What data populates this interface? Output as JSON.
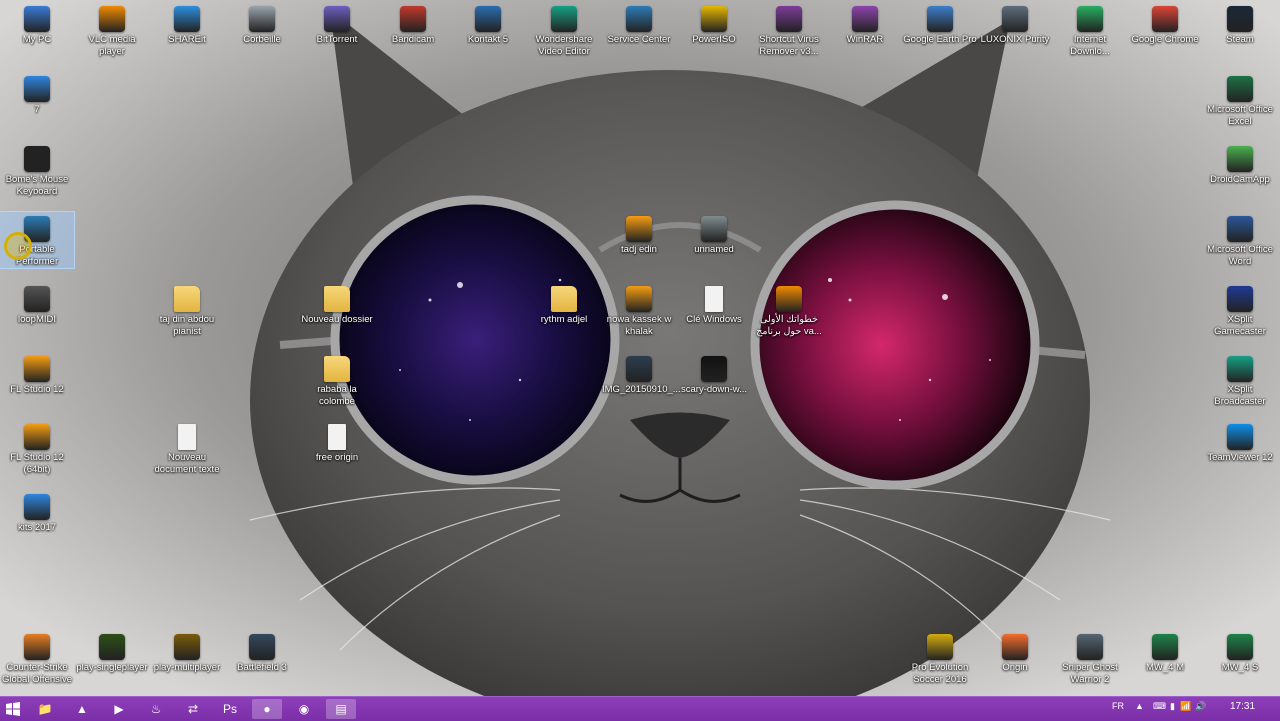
{
  "desktop": {
    "icons": [
      {
        "label": "My PC",
        "icon": "computer-icon",
        "color": "#3a7bd5"
      },
      {
        "label": "VLC media player",
        "icon": "vlc-icon",
        "color": "#f08a00"
      },
      {
        "label": "SHAREit",
        "icon": "shareit-icon",
        "color": "#2b8fe0"
      },
      {
        "label": "Corbeille",
        "icon": "recycle-bin-icon",
        "color": "#9aa4ad"
      },
      {
        "label": "BitTorrent",
        "icon": "bittorrent-icon",
        "color": "#6b5fc0"
      },
      {
        "label": "Bandicam",
        "icon": "bandicam-icon",
        "color": "#c0392b"
      },
      {
        "label": "Kontakt 5",
        "icon": "kontakt-icon",
        "color": "#2b6cb0"
      },
      {
        "label": "Wondershare Video Editor",
        "icon": "video-editor-icon",
        "color": "#16a085"
      },
      {
        "label": "Service Center",
        "icon": "service-center-icon",
        "color": "#2c7bb6"
      },
      {
        "label": "PowerISO",
        "icon": "poweriso-icon",
        "color": "#e6b800"
      },
      {
        "label": "Shortcut Virus Remover v3...",
        "icon": "virus-remover-icon",
        "color": "#7d3c98"
      },
      {
        "label": "WinRAR",
        "icon": "winrar-icon",
        "color": "#8e44ad"
      },
      {
        "label": "Google Earth Pro",
        "icon": "google-earth-icon",
        "color": "#3d7ec9"
      },
      {
        "label": "LUXONIX Purity",
        "icon": "luxonix-icon",
        "color": "#5d6d7e"
      },
      {
        "label": "Internet Downlo...",
        "icon": "internet-download-icon",
        "color": "#27ae60"
      },
      {
        "label": "Google Chrome",
        "icon": "chrome-icon",
        "color": "#db4437"
      },
      {
        "label": "Steam",
        "icon": "steam-icon",
        "color": "#1b2838"
      },
      {
        "label": "7",
        "icon": "gamepad-icon",
        "color": "#2e86de"
      },
      {
        "label": "Microsoft Office Excel",
        "icon": "excel-icon",
        "color": "#1e7145"
      },
      {
        "label": "Bome's Mouse Keyboard",
        "icon": "piano-keyboard-icon",
        "color": "#222222"
      },
      {
        "label": "DroidCamApp",
        "icon": "droidcam-icon",
        "color": "#4caf50"
      },
      {
        "label": "Portable Performer",
        "icon": "performer-icon",
        "color": "#2c7bb6"
      },
      {
        "label": "Microsoft Office Word",
        "icon": "word-icon",
        "color": "#2b579a"
      },
      {
        "label": "tadj edin",
        "icon": "fl-studio-icon",
        "color": "#f39c12"
      },
      {
        "label": "unnamed",
        "icon": "image-file-icon",
        "color": "#7f8c8d"
      },
      {
        "label": "loopMIDI",
        "icon": "loopmidi-icon",
        "color": "#555555"
      },
      {
        "label": "taj din abdou pianist",
        "icon": "folder-icon",
        "color": "#e3b43f"
      },
      {
        "label": "Nouveau dossier",
        "icon": "folder-icon",
        "color": "#e3b43f"
      },
      {
        "label": "rythm adjel",
        "icon": "folder-icon",
        "color": "#e3b43f"
      },
      {
        "label": "nowa kassek w khalak",
        "icon": "fl-studio-icon",
        "color": "#f39c12"
      },
      {
        "label": "Clé Windows",
        "icon": "text-file-icon",
        "color": "#f2f2f2"
      },
      {
        "label": "خطواتك الأولى حول برنامج va...",
        "icon": "vlc-file-icon",
        "color": "#f08a00"
      },
      {
        "label": "XSplit Gamecaster",
        "icon": "xsplit-gamecaster-icon",
        "color": "#1f3a93"
      },
      {
        "label": "FL Studio 12",
        "icon": "fl-studio-icon",
        "color": "#f39c12"
      },
      {
        "label": "rababa la colombe",
        "icon": "folder-icon",
        "color": "#e3b43f"
      },
      {
        "label": "IMG_20150910_...",
        "icon": "image-file-icon",
        "color": "#2c3e50"
      },
      {
        "label": "scary-down-w...",
        "icon": "image-file-icon",
        "color": "#111111"
      },
      {
        "label": "XSplit Broadcaster",
        "icon": "xsplit-broadcaster-icon",
        "color": "#16a085"
      },
      {
        "label": "FL Studio 12 (64bit)",
        "icon": "fl-studio-icon",
        "color": "#f39c12"
      },
      {
        "label": "Nouveau document texte",
        "icon": "text-file-icon",
        "color": "#f2f2f2"
      },
      {
        "label": "free origin",
        "icon": "text-file-icon",
        "color": "#f2f2f2"
      },
      {
        "label": "TeamViewer 12",
        "icon": "teamviewer-icon",
        "color": "#0e8ee9"
      },
      {
        "label": "kits 2017",
        "icon": "gamepad-icon",
        "color": "#2e86de"
      },
      {
        "label": "Counter-Strike Global Offensive",
        "icon": "csgo-icon",
        "color": "#e67e22"
      },
      {
        "label": "play-singleplayer",
        "icon": "cod-icon",
        "color": "#2d5016"
      },
      {
        "label": "play-multiplayer",
        "icon": "cod-mp-icon",
        "color": "#7a5c0a"
      },
      {
        "label": "Battlefield 3",
        "icon": "battlefield-icon",
        "color": "#34495e"
      },
      {
        "label": "Pro Evolution Soccer 2016",
        "icon": "pes-icon",
        "color": "#d4ac0d"
      },
      {
        "label": "Origin",
        "icon": "origin-icon",
        "color": "#f56c2d"
      },
      {
        "label": "Sniper Ghost Warrior 2",
        "icon": "sniper-icon",
        "color": "#566573"
      },
      {
        "label": "MW_4 M",
        "icon": "mw-icon",
        "color": "#1e8449"
      },
      {
        "label": "MW_4 S",
        "icon": "mw-icon",
        "color": "#1e8449"
      }
    ]
  },
  "taskbar": {
    "start_icon": "windows-start-icon",
    "apps": [
      {
        "name": "file-explorer",
        "glyph": "📁"
      },
      {
        "name": "vlc",
        "glyph": "▲"
      },
      {
        "name": "media-player",
        "glyph": "▶"
      },
      {
        "name": "steam",
        "glyph": "♨"
      },
      {
        "name": "teamviewer",
        "glyph": "⇄"
      },
      {
        "name": "photoshop",
        "glyph": "Ps"
      },
      {
        "name": "bandicam",
        "glyph": "●"
      },
      {
        "name": "chrome",
        "glyph": "◉"
      },
      {
        "name": "notepad",
        "glyph": "▤"
      }
    ],
    "language": "FR",
    "time": "17:31"
  }
}
